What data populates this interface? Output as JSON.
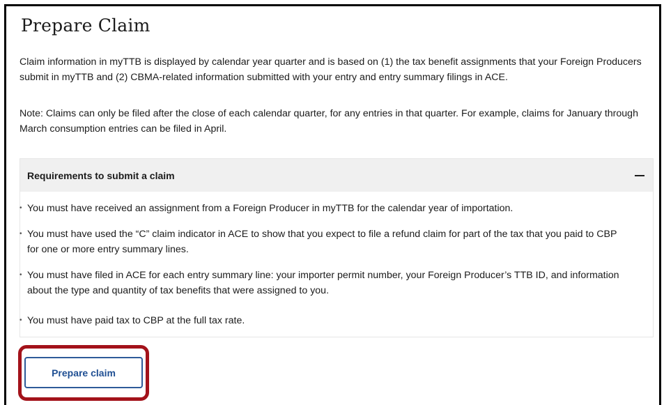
{
  "page": {
    "title": "Prepare Claim",
    "intro": "Claim information in myTTB is displayed by calendar year quarter and is based on (1) the tax benefit assignments that your Foreign Producers submit in myTTB and (2) CBMA-related information submitted with your entry and entry summary filings in ACE.",
    "note": "Note: Claims can only be filed after the close of each calendar quarter, for any entries in that quarter. For example, claims for January through March consumption entries can be filed in April."
  },
  "requirements": {
    "title": "Requirements to submit a claim",
    "expanded": true,
    "toggle_icon": "minus-icon",
    "bullet": "•",
    "items": [
      "You must have received an assignment from a Foreign Producer in myTTB for the calendar year of importation.",
      "You must have used the “C” claim indicator in ACE to show that you expect to file a refund claim for part of the tax that you paid to CBP for one or more entry summary lines.",
      "You must have filed in ACE for each entry summary line: your importer permit number, your Foreign Producer’s TTB ID, and information about the type and quantity of tax benefits that were assigned to you.",
      "You must have paid tax to CBP at the full tax rate."
    ]
  },
  "actions": {
    "prepare_label": "Prepare claim"
  },
  "colors": {
    "button_border": "#2e5a99",
    "button_text": "#1f4f93",
    "highlight": "#a3121a",
    "accordion_header_bg": "#f0f0f0"
  }
}
